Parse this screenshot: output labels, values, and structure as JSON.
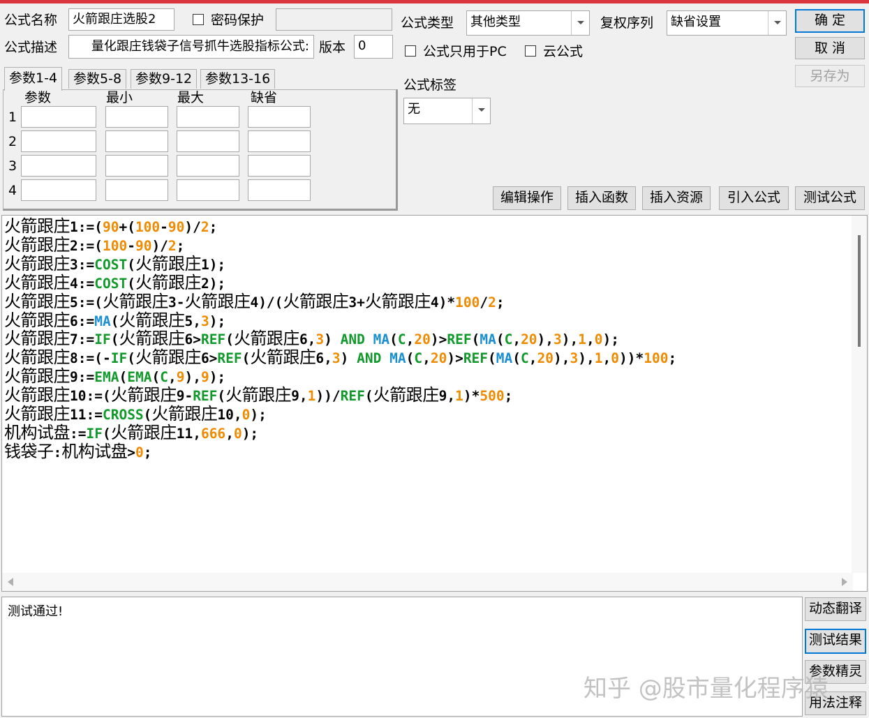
{
  "header": {
    "formula_name_label": "公式名称",
    "formula_name_value": "火箭跟庄选股2",
    "password_label": "密码保护",
    "password_value": "",
    "formula_desc_label": "公式描述",
    "formula_desc_value": "量化跟庄钱袋子信号抓牛选股指标公式:",
    "version_label": "版本",
    "version_value": "0",
    "formula_type_label": "公式类型",
    "formula_type_value": "其他类型",
    "adjust_label": "复权序列",
    "adjust_value": "缺省设置",
    "pc_only_label": "公式只用于PC",
    "cloud_label": "云公式",
    "tag_label": "公式标签",
    "tag_value": "无"
  },
  "buttons": {
    "ok": "确  定",
    "cancel": "取  消",
    "save_as": "另存为",
    "edit_ops": "编辑操作",
    "insert_func": "插入函数",
    "insert_res": "插入资源",
    "import_formula": "引入公式",
    "test_formula": "测试公式"
  },
  "param_tabs": [
    "参数1-4",
    "参数5-8",
    "参数9-12",
    "参数13-16"
  ],
  "param_headers": [
    "参数",
    "最小",
    "最大",
    "缺省"
  ],
  "param_rows": [
    "1",
    "2",
    "3",
    "4"
  ],
  "code_lines": [
    [
      [
        "t",
        "火箭跟庄"
      ],
      [
        "k",
        "1:=("
      ],
      [
        "n",
        "90"
      ],
      [
        "k",
        "+("
      ],
      [
        "n",
        "100"
      ],
      [
        "k",
        "-"
      ],
      [
        "n",
        "90"
      ],
      [
        "k",
        ")/"
      ],
      [
        "n",
        "2"
      ],
      [
        "k",
        ";"
      ]
    ],
    [
      [
        "t",
        "火箭跟庄"
      ],
      [
        "k",
        "2:=("
      ],
      [
        "n",
        "100"
      ],
      [
        "k",
        "-"
      ],
      [
        "n",
        "90"
      ],
      [
        "k",
        ")/"
      ],
      [
        "n",
        "2"
      ],
      [
        "k",
        ";"
      ]
    ],
    [
      [
        "t",
        "火箭跟庄"
      ],
      [
        "k",
        "3:="
      ],
      [
        "g",
        "COST"
      ],
      [
        "k",
        "("
      ],
      [
        "t",
        "火箭跟庄"
      ],
      [
        "k",
        "1);"
      ]
    ],
    [
      [
        "t",
        "火箭跟庄"
      ],
      [
        "k",
        "4:="
      ],
      [
        "g",
        "COST"
      ],
      [
        "k",
        "("
      ],
      [
        "t",
        "火箭跟庄"
      ],
      [
        "k",
        "2);"
      ]
    ],
    [
      [
        "t",
        "火箭跟庄"
      ],
      [
        "k",
        "5:=("
      ],
      [
        "t",
        "火箭跟庄"
      ],
      [
        "k",
        "3-"
      ],
      [
        "t",
        "火箭跟庄"
      ],
      [
        "k",
        "4)/("
      ],
      [
        "t",
        "火箭跟庄"
      ],
      [
        "k",
        "3+"
      ],
      [
        "t",
        "火箭跟庄"
      ],
      [
        "k",
        "4)*"
      ],
      [
        "n",
        "100"
      ],
      [
        "k",
        "/"
      ],
      [
        "n",
        "2"
      ],
      [
        "k",
        ";"
      ]
    ],
    [
      [
        "t",
        "火箭跟庄"
      ],
      [
        "k",
        "6:="
      ],
      [
        "b",
        "MA"
      ],
      [
        "k",
        "("
      ],
      [
        "t",
        "火箭跟庄"
      ],
      [
        "k",
        "5,"
      ],
      [
        "n",
        "3"
      ],
      [
        "k",
        ");"
      ]
    ],
    [
      [
        "t",
        "火箭跟庄"
      ],
      [
        "k",
        "7:="
      ],
      [
        "g",
        "IF"
      ],
      [
        "k",
        "("
      ],
      [
        "t",
        "火箭跟庄"
      ],
      [
        "k",
        "6>"
      ],
      [
        "g",
        "REF"
      ],
      [
        "k",
        "("
      ],
      [
        "t",
        "火箭跟庄"
      ],
      [
        "k",
        "6,"
      ],
      [
        "n",
        "3"
      ],
      [
        "k",
        ") "
      ],
      [
        "g",
        "AND"
      ],
      [
        "k",
        " "
      ],
      [
        "b",
        "MA"
      ],
      [
        "k",
        "("
      ],
      [
        "g",
        "C"
      ],
      [
        "k",
        ","
      ],
      [
        "n",
        "20"
      ],
      [
        "k",
        ")>"
      ],
      [
        "g",
        "REF"
      ],
      [
        "k",
        "("
      ],
      [
        "b",
        "MA"
      ],
      [
        "k",
        "("
      ],
      [
        "g",
        "C"
      ],
      [
        "k",
        ","
      ],
      [
        "n",
        "20"
      ],
      [
        "k",
        "),"
      ],
      [
        "n",
        "3"
      ],
      [
        "k",
        "),"
      ],
      [
        "n",
        "1"
      ],
      [
        "k",
        ","
      ],
      [
        "n",
        "0"
      ],
      [
        "k",
        ");"
      ]
    ],
    [
      [
        "t",
        "火箭跟庄"
      ],
      [
        "k",
        "8:=(-"
      ],
      [
        "g",
        "IF"
      ],
      [
        "k",
        "("
      ],
      [
        "t",
        "火箭跟庄"
      ],
      [
        "k",
        "6>"
      ],
      [
        "g",
        "REF"
      ],
      [
        "k",
        "("
      ],
      [
        "t",
        "火箭跟庄"
      ],
      [
        "k",
        "6,"
      ],
      [
        "n",
        "3"
      ],
      [
        "k",
        ") "
      ],
      [
        "g",
        "AND"
      ],
      [
        "k",
        " "
      ],
      [
        "b",
        "MA"
      ],
      [
        "k",
        "("
      ],
      [
        "g",
        "C"
      ],
      [
        "k",
        ","
      ],
      [
        "n",
        "20"
      ],
      [
        "k",
        ")>"
      ],
      [
        "g",
        "REF"
      ],
      [
        "k",
        "("
      ],
      [
        "b",
        "MA"
      ],
      [
        "k",
        "("
      ],
      [
        "g",
        "C"
      ],
      [
        "k",
        ","
      ],
      [
        "n",
        "20"
      ],
      [
        "k",
        "),"
      ],
      [
        "n",
        "3"
      ],
      [
        "k",
        "),"
      ],
      [
        "n",
        "1"
      ],
      [
        "k",
        ","
      ],
      [
        "n",
        "0"
      ],
      [
        "k",
        "))*"
      ],
      [
        "n",
        "100"
      ],
      [
        "k",
        ";"
      ]
    ],
    [
      [
        "t",
        "火箭跟庄"
      ],
      [
        "k",
        "9:="
      ],
      [
        "g",
        "EMA"
      ],
      [
        "k",
        "("
      ],
      [
        "g",
        "EMA"
      ],
      [
        "k",
        "("
      ],
      [
        "g",
        "C"
      ],
      [
        "k",
        ","
      ],
      [
        "n",
        "9"
      ],
      [
        "k",
        "),"
      ],
      [
        "n",
        "9"
      ],
      [
        "k",
        ");"
      ]
    ],
    [
      [
        "t",
        "火箭跟庄"
      ],
      [
        "k",
        "10:=("
      ],
      [
        "t",
        "火箭跟庄"
      ],
      [
        "k",
        "9-"
      ],
      [
        "g",
        "REF"
      ],
      [
        "k",
        "("
      ],
      [
        "t",
        "火箭跟庄"
      ],
      [
        "k",
        "9,"
      ],
      [
        "n",
        "1"
      ],
      [
        "k",
        "))/"
      ],
      [
        "g",
        "REF"
      ],
      [
        "k",
        "("
      ],
      [
        "t",
        "火箭跟庄"
      ],
      [
        "k",
        "9,"
      ],
      [
        "n",
        "1"
      ],
      [
        "k",
        ")*"
      ],
      [
        "n",
        "500"
      ],
      [
        "k",
        ";"
      ]
    ],
    [
      [
        "t",
        "火箭跟庄"
      ],
      [
        "k",
        "11:="
      ],
      [
        "g",
        "CROSS"
      ],
      [
        "k",
        "("
      ],
      [
        "t",
        "火箭跟庄"
      ],
      [
        "k",
        "10,"
      ],
      [
        "n",
        "0"
      ],
      [
        "k",
        ");"
      ]
    ],
    [
      [
        "t",
        "机构试盘"
      ],
      [
        "k",
        ":="
      ],
      [
        "g",
        "IF"
      ],
      [
        "k",
        "("
      ],
      [
        "t",
        "火箭跟庄"
      ],
      [
        "k",
        "11,"
      ],
      [
        "n",
        "666"
      ],
      [
        "k",
        ","
      ],
      [
        "n",
        "0"
      ],
      [
        "k",
        ");"
      ]
    ],
    [
      [
        "t",
        "钱袋子"
      ],
      [
        "k",
        ":"
      ],
      [
        "t",
        "机构试盘"
      ],
      [
        "k",
        ">"
      ],
      [
        "n",
        "0"
      ],
      [
        "k",
        ";"
      ]
    ]
  ],
  "syntax_colors": {
    "k": "#000000",
    "t": "#000000",
    "g": "#119a2b",
    "b": "#1a8fd1",
    "n": "#f08a00"
  },
  "result_text": "测试通过!",
  "side_buttons": [
    "动态翻译",
    "测试结果",
    "参数精灵",
    "用法注释"
  ],
  "watermark": "知乎 @股市量化程序猿"
}
